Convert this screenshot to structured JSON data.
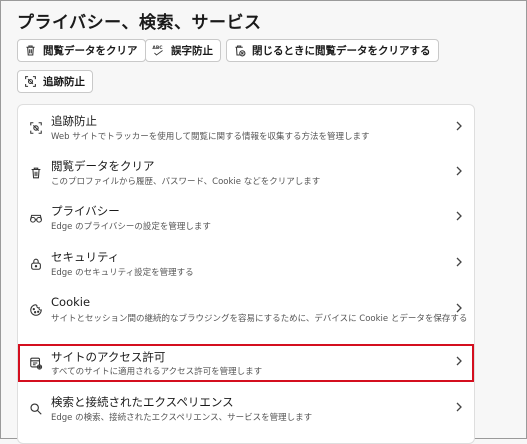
{
  "page": {
    "title": "プライバシー、検索、サービス"
  },
  "quick_actions": [
    {
      "label": "閲覧データをクリア",
      "icon": "trash-icon"
    },
    {
      "label": "誤字防止",
      "icon": "spellcheck-icon"
    },
    {
      "label": "閉じるときに閲覧データをクリアする",
      "icon": "clear-on-close-icon"
    },
    {
      "label": "追跡防止",
      "icon": "tracking-prevention-icon"
    }
  ],
  "settings": [
    {
      "title": "追跡防止",
      "description": "Web サイトでトラッカーを使用して閲覧に関する情報を収集する方法を管理します",
      "icon": "tracking-prevention-icon"
    },
    {
      "title": "閲覧データをクリア",
      "description": "このプロファイルから履歴、パスワード、Cookie などをクリアします",
      "icon": "trash-icon"
    },
    {
      "title": "プライバシー",
      "description": "Edge のプライバシーの設定を管理します",
      "icon": "glasses-icon"
    },
    {
      "title": "セキュリティ",
      "description": "Edge のセキュリティ設定を管理する",
      "icon": "lock-icon"
    },
    {
      "title": "Cookie",
      "description": "サイトとセッション間の継続的なブラウジングを容易にするために、デバイスに Cookie とデータを保存する",
      "icon": "cookie-icon"
    },
    {
      "title": "サイトのアクセス許可",
      "description": "すべてのサイトに適用されるアクセス許可を管理します",
      "icon": "site-permissions-icon"
    },
    {
      "title": "検索と接続されたエクスペリエンス",
      "description": "Edge の検索、接続されたエクスペリエンス、サービスを管理します",
      "icon": "search-icon"
    }
  ],
  "colors": {
    "highlight": "#d40f1f"
  }
}
